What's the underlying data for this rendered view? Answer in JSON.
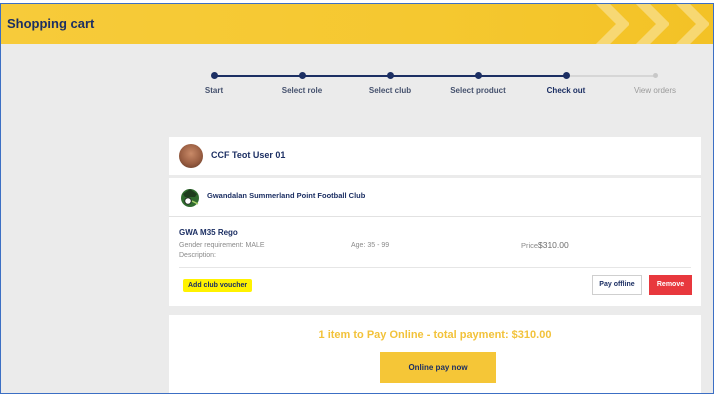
{
  "header": {
    "title": "Shopping cart"
  },
  "stepper": {
    "steps": [
      "Start",
      "Select role",
      "Select club",
      "Select product",
      "Check out",
      "View orders"
    ],
    "current": "Check out"
  },
  "user": {
    "name": "CCF Teot User 01"
  },
  "club": {
    "name": "Gwandalan Summerland Point Football Club"
  },
  "product": {
    "name": "GWA M35 Rego",
    "gender": "Gender requirement: MALE",
    "description": "Description:",
    "age": "Age: 35 - 99",
    "price_label": "Price:",
    "price": "$310.00"
  },
  "actions": {
    "voucher": "Add club voucher",
    "pay_offline": "Pay offline",
    "remove": "Remove"
  },
  "payment": {
    "summary": "1 item to Pay Online - total payment: $310.00",
    "button": "Online pay now"
  },
  "colors": {
    "header": "#f5c830",
    "navy": "#1c2f63",
    "remove": "#e8383d",
    "highlight": "#fff200",
    "accent": "#f5c637"
  }
}
